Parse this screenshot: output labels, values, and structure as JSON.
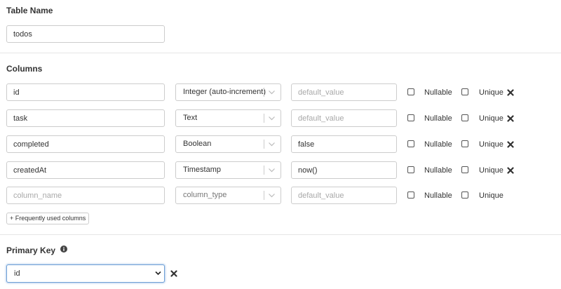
{
  "table_name": {
    "heading": "Table Name",
    "value": "todos"
  },
  "columns": {
    "heading": "Columns",
    "nullable_label": "Nullable",
    "unique_label": "Unique",
    "default_placeholder": "default_value",
    "rows": [
      {
        "name": "id",
        "type": "Integer (auto-increment)",
        "default_value": "",
        "nullable": false,
        "unique": false,
        "removable": true
      },
      {
        "name": "task",
        "type": "Text",
        "default_value": "",
        "nullable": false,
        "unique": false,
        "removable": true
      },
      {
        "name": "completed",
        "type": "Boolean",
        "default_value": "false",
        "nullable": false,
        "unique": false,
        "removable": true
      },
      {
        "name": "createdAt",
        "type": "Timestamp",
        "default_value": "now()",
        "nullable": false,
        "unique": false,
        "removable": true
      }
    ],
    "new_row": {
      "name_placeholder": "column_name",
      "type_placeholder": "column_type",
      "default_placeholder": "default_value"
    },
    "frequent_button": "+ Frequently used columns"
  },
  "primary_key": {
    "heading": "Primary Key",
    "selected": "id"
  },
  "icons": {
    "remove": "close-x-icon",
    "dropdown": "chevron-down-icon",
    "info": "info-icon"
  },
  "colors": {
    "focus_border": "#6fa0d6",
    "input_border": "#cccccc",
    "divider": "#e6e6e6"
  }
}
